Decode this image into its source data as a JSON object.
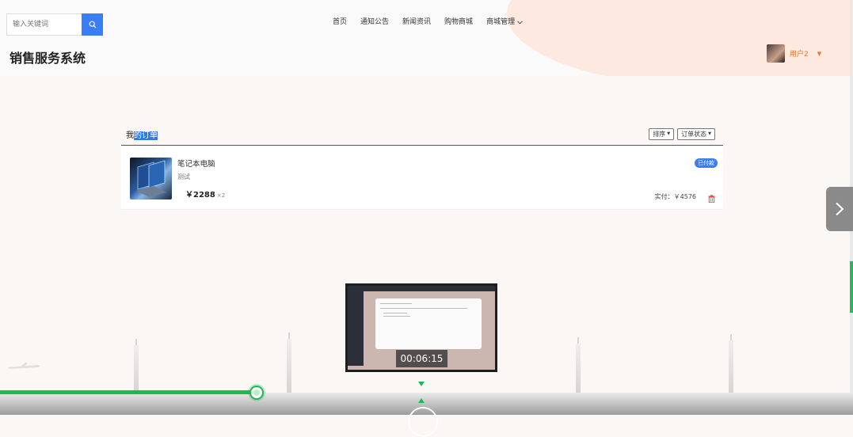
{
  "search": {
    "placeholder": "输入关键词",
    "icon": "search-icon"
  },
  "nav": {
    "items": [
      "首页",
      "通知公告",
      "新闻资讯",
      "购物商城"
    ],
    "dropdown_label": "商城管理"
  },
  "site_title": "销售服务系统",
  "user": {
    "name": "用户2"
  },
  "orders": {
    "title_prefix": "我",
    "title_highlight": "的订单",
    "filters": [
      "排序",
      "订单状态"
    ],
    "items": [
      {
        "name": "笔记本电脑",
        "desc": "测试",
        "price": "￥2288",
        "qty": "×2",
        "status": "已付款",
        "paid_label": "实付：",
        "paid_amount": "￥4576"
      }
    ]
  },
  "player": {
    "preview_time": "00:06:15",
    "progress_fraction": 0.3
  },
  "colors": {
    "accent_blue": "#3b7cf7",
    "user_orange": "#e8762b",
    "progress_green": "#1db954",
    "trash_red": "#e74c3c"
  }
}
